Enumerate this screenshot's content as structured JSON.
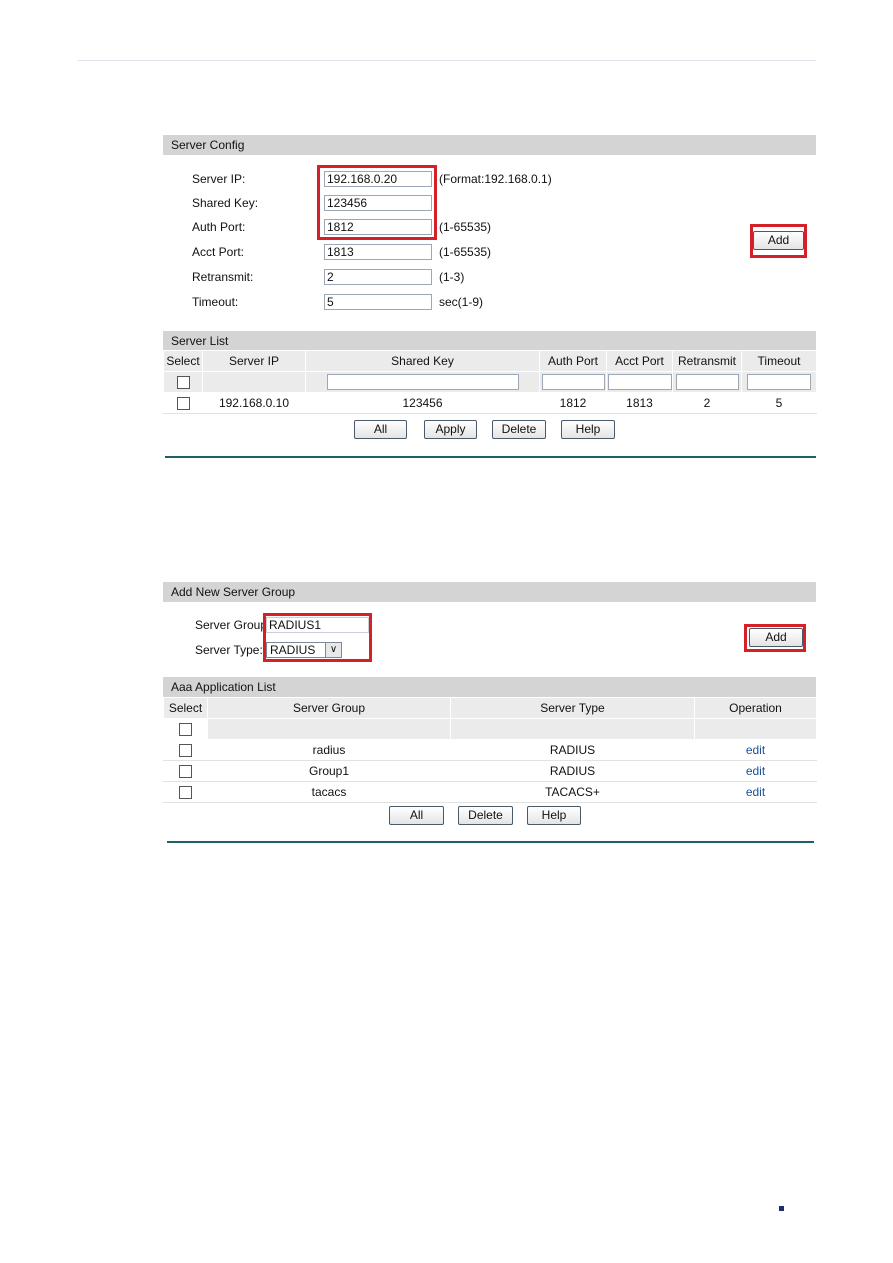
{
  "server_config": {
    "title": "Server Config",
    "fields": [
      {
        "label": "Server IP:",
        "value": "192.168.0.20",
        "hint": "(Format:192.168.0.1)"
      },
      {
        "label": "Shared Key:",
        "value": "123456",
        "hint": ""
      },
      {
        "label": "Auth Port:",
        "value": "1812",
        "hint": "(1-65535)"
      },
      {
        "label": "Acct Port:",
        "value": "1813",
        "hint": "(1-65535)"
      },
      {
        "label": "Retransmit:",
        "value": "2",
        "hint": "(1-3)"
      },
      {
        "label": "Timeout:",
        "value": "5",
        "hint": "sec(1-9)"
      }
    ],
    "add_label": "Add"
  },
  "server_list": {
    "title": "Server List",
    "columns": [
      "Select",
      "Server IP",
      "Shared Key",
      "Auth Port",
      "Acct Port",
      "Retransmit",
      "Timeout"
    ],
    "rows": [
      {
        "server_ip": "192.168.0.10",
        "shared_key": "123456",
        "auth_port": "1812",
        "acct_port": "1813",
        "retransmit": "2",
        "timeout": "5"
      }
    ],
    "buttons": [
      "All",
      "Apply",
      "Delete",
      "Help"
    ]
  },
  "add_group": {
    "title": "Add New Server Group",
    "group_label": "Server Group:",
    "group_value": "RADIUS1",
    "type_label": "Server Type:",
    "type_value": "RADIUS",
    "add_label": "Add"
  },
  "app_list": {
    "title": "Aaa Application List",
    "columns": [
      "Select",
      "Server Group",
      "Server Type",
      "Operation"
    ],
    "rows": [
      {
        "group": "radius",
        "type": "RADIUS",
        "op": "edit"
      },
      {
        "group": "Group1",
        "type": "RADIUS",
        "op": "edit"
      },
      {
        "group": "tacacs",
        "type": "TACACS+",
        "op": "edit"
      }
    ],
    "buttons": [
      "All",
      "Delete",
      "Help"
    ]
  },
  "colors": {
    "highlight": "#d52027",
    "link": "#1a4f9a",
    "header_bg": "#d4d4d4"
  }
}
